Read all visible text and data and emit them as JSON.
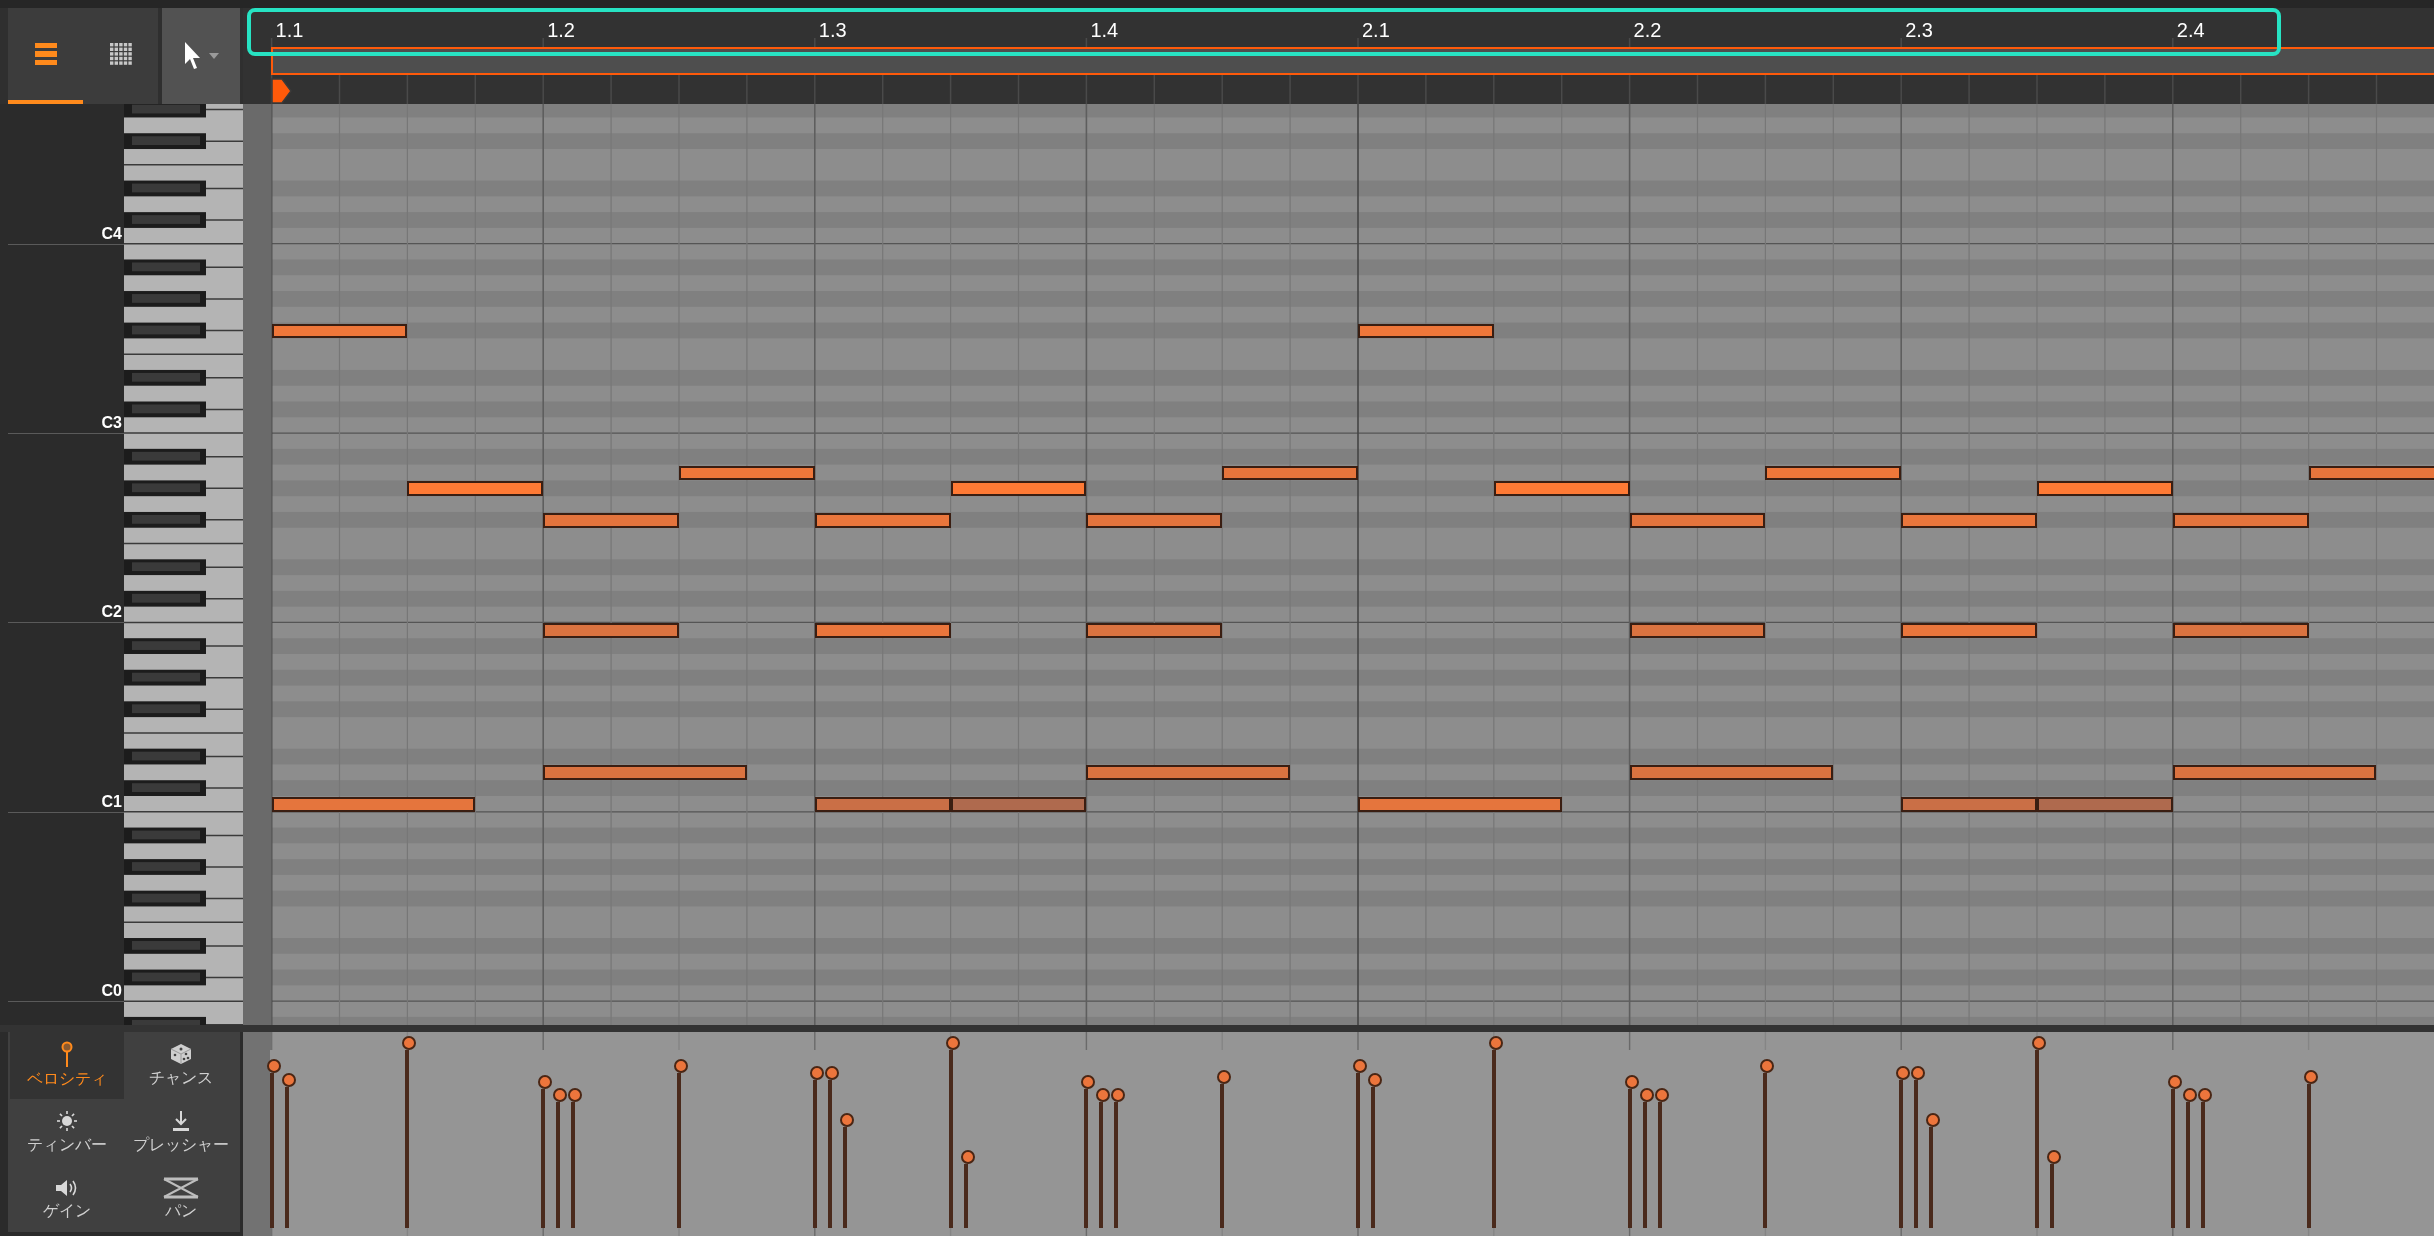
{
  "view_buttons": [
    {
      "kind": "piano",
      "selected": true
    },
    {
      "kind": "grid",
      "selected": false
    }
  ],
  "ruler": {
    "labels": [
      "1.1",
      "1.2",
      "1.3",
      "1.4",
      "2.1",
      "2.2",
      "2.3",
      "2.4"
    ]
  },
  "octave_labels": [
    "C4",
    "C3",
    "C2",
    "C1",
    "C0"
  ],
  "notes": [
    {
      "level": 0.87
    },
    {
      "level": 0.79
    },
    {
      "level": 1.0
    },
    {
      "level": 0.78
    },
    {
      "level": 0.71
    },
    {
      "level": 0.71
    },
    {
      "level": 0.87
    },
    {
      "level": 0.83
    },
    {
      "level": 0.83
    },
    {
      "level": 0.57
    },
    {
      "level": 1.0
    },
    {
      "level": 0.36
    },
    {
      "level": 0.78
    },
    {
      "level": 0.71
    },
    {
      "level": 0.71
    },
    {
      "level": 0.81
    },
    {
      "level": 0.87
    },
    {
      "level": 0.79
    },
    {
      "level": 1.0
    },
    {
      "level": 0.78
    },
    {
      "level": 0.71
    },
    {
      "level": 0.71
    },
    {
      "level": 0.87
    },
    {
      "level": 0.83
    },
    {
      "level": 0.83
    },
    {
      "level": 0.57
    },
    {
      "level": 1.0
    },
    {
      "level": 0.36
    },
    {
      "level": 0.78
    },
    {
      "level": 0.71
    },
    {
      "level": 0.71
    },
    {
      "level": 0.81
    }
  ],
  "expression_tabs": [
    {
      "kind": "velocity",
      "label": "ベロシティ",
      "selected": true
    },
    {
      "kind": "chance",
      "label": "チャンス",
      "selected": false
    },
    {
      "kind": "timbre",
      "label": "ティンバー",
      "selected": false
    },
    {
      "kind": "pressure",
      "label": "プレッシャー",
      "selected": false
    },
    {
      "kind": "gain",
      "label": "ゲイン",
      "selected": false
    },
    {
      "kind": "pan",
      "label": "パン",
      "selected": false
    }
  ]
}
